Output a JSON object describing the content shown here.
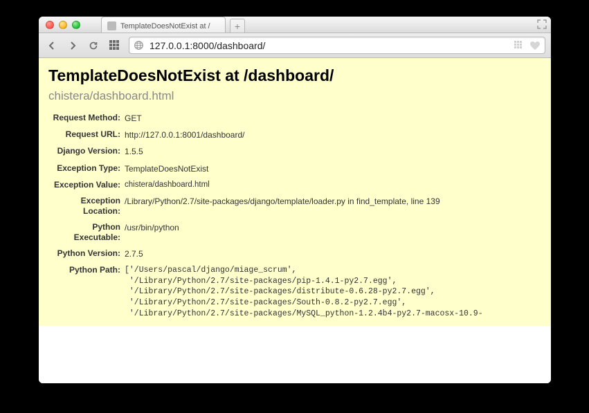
{
  "window": {
    "tab_title": "TemplateDoesNotExist at /"
  },
  "url": "127.0.0.1:8000/dashboard/",
  "error": {
    "heading": "TemplateDoesNotExist at /dashboard/",
    "subheading": "chistera/dashboard.html",
    "rows": {
      "request_method_label": "Request Method:",
      "request_method": "GET",
      "request_url_label": "Request URL:",
      "request_url": "http://127.0.0.1:8001/dashboard/",
      "django_version_label": "Django Version:",
      "django_version": "1.5.5",
      "exception_type_label": "Exception Type:",
      "exception_type": "TemplateDoesNotExist",
      "exception_value_label": "Exception Value:",
      "exception_value": "chistera/dashboard.html",
      "exception_location_label": "Exception Location:",
      "exception_location": "/Library/Python/2.7/site-packages/django/template/loader.py in find_template, line 139",
      "python_executable_label": "Python Executable:",
      "python_executable": "/usr/bin/python",
      "python_version_label": "Python Version:",
      "python_version": "2.7.5",
      "python_path_label": "Python Path:",
      "python_path": "['/Users/pascal/django/miage_scrum',\n '/Library/Python/2.7/site-packages/pip-1.4.1-py2.7.egg',\n '/Library/Python/2.7/site-packages/distribute-0.6.28-py2.7.egg',\n '/Library/Python/2.7/site-packages/South-0.8.2-py2.7.egg',\n '/Library/Python/2.7/site-packages/MySQL_python-1.2.4b4-py2.7-macosx-10.9-"
    }
  }
}
